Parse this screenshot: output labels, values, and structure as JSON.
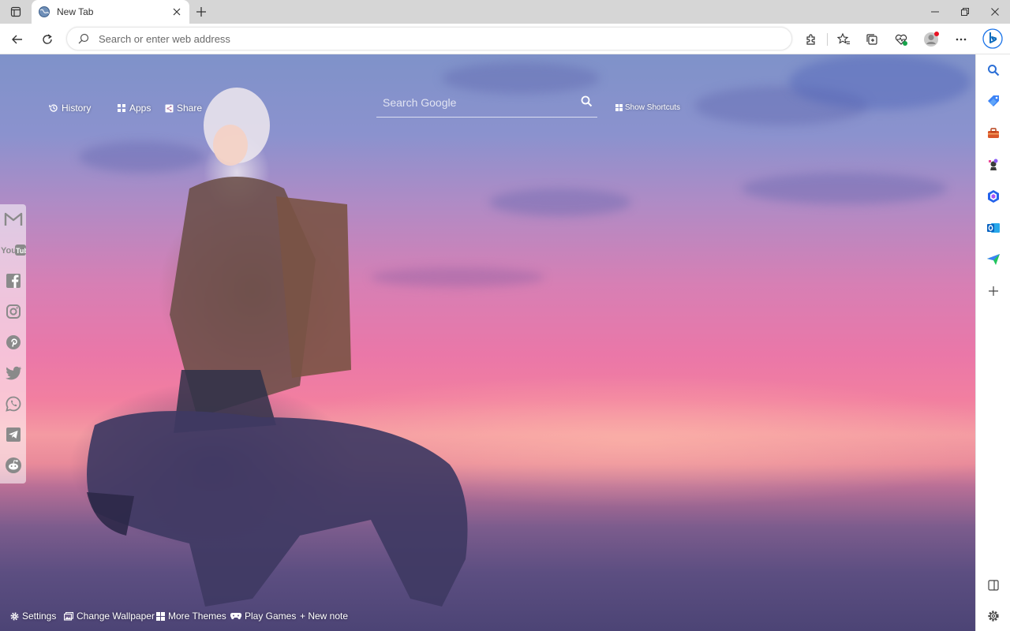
{
  "window": {
    "tab_title": "New Tab",
    "controls": [
      "minimize-icon",
      "restore-icon",
      "close-icon"
    ]
  },
  "toolbar": {
    "address_placeholder": "Search or enter web address",
    "address_value": "",
    "profile_notification_color": "#e81123"
  },
  "ntp": {
    "history_label": "History",
    "apps_label": "Apps",
    "share_label": "Share",
    "search_placeholder": "Search Google",
    "show_shortcuts_label": "Show Shortcuts"
  },
  "social": {
    "items": [
      "gmail-icon",
      "youtube-icon",
      "facebook-icon",
      "instagram-icon",
      "pinterest-icon",
      "twitter-icon",
      "whatsapp-icon",
      "telegram-icon",
      "reddit-icon"
    ]
  },
  "bottom": {
    "settings_label": "Settings",
    "change_wallpaper_label": "Change Wallpaper",
    "more_themes_label": "More Themes",
    "play_games_label": "Play Games",
    "new_note_label": "+ New note"
  },
  "sidebar": {
    "items": [
      "search-icon",
      "shopping-tag-icon",
      "tools-icon",
      "games-icon",
      "microsoft365-icon",
      "outlook-icon",
      "send-icon",
      "add-icon"
    ],
    "bottom_items": [
      "split-screen-icon",
      "settings-icon"
    ]
  },
  "colors": {
    "accent": "#0f6cbd",
    "sky_top": "#7f92c9",
    "sky_pink": "#ea77a8",
    "sea": "#5c4e81"
  }
}
